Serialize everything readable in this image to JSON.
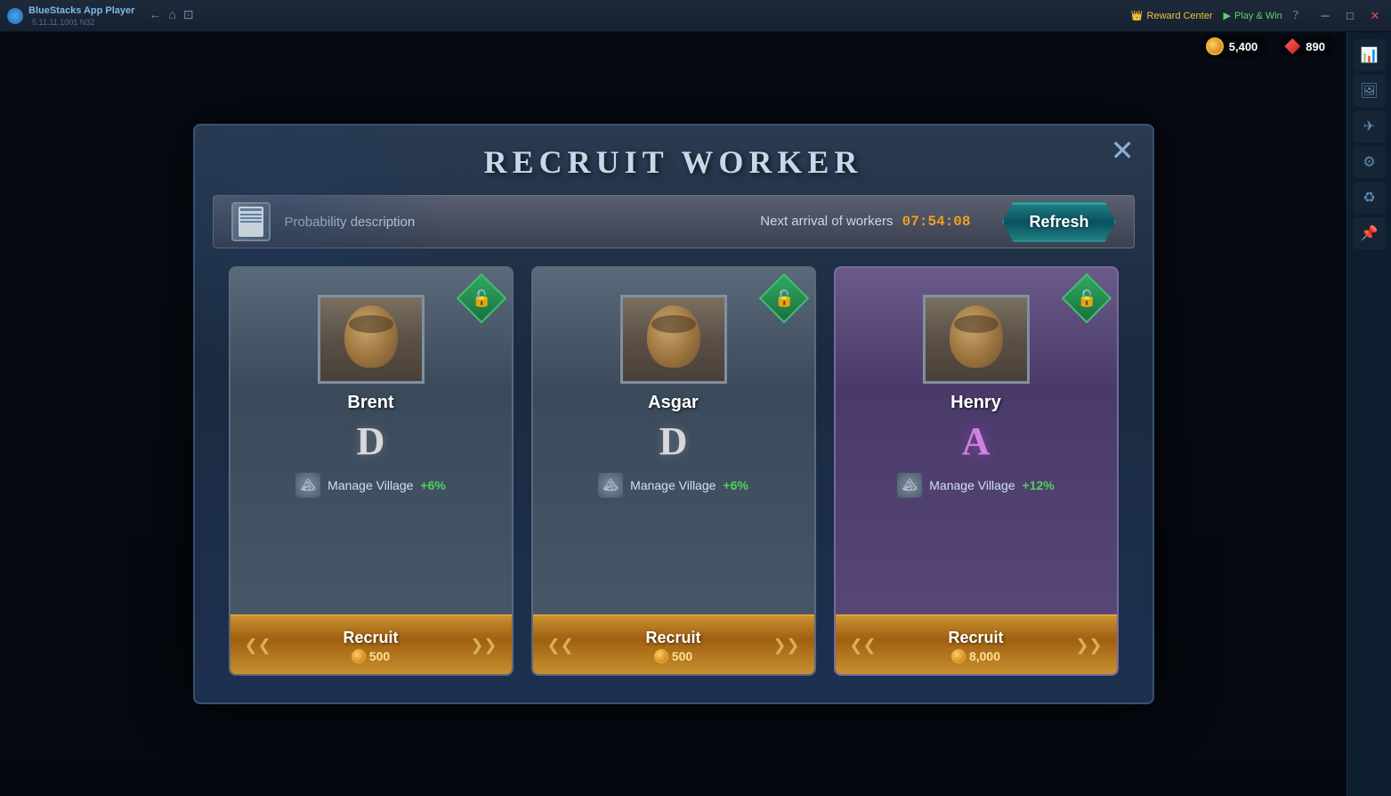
{
  "app": {
    "name": "BlueStacks App Player",
    "version": "5.11.11.1001 N32"
  },
  "titlebar": {
    "back_label": "←",
    "home_label": "⌂",
    "window_label": "⊡",
    "reward_center": "Reward Center",
    "play_win": "Play & Win",
    "minimize": "─",
    "maximize": "□",
    "close": "✕"
  },
  "currency": {
    "coins": "5,400",
    "gems": "890"
  },
  "modal": {
    "title": "RECRUIT WORKER",
    "close_label": "✕",
    "prob_label": "Probability description",
    "arrival_label": "Next arrival of workers",
    "timer": "07:54:08",
    "refresh_label": "Refresh"
  },
  "workers": [
    {
      "name": "Brent",
      "grade": "D",
      "grade_class": "grade-d",
      "skill_name": "Manage Village",
      "skill_bonus": "+6%",
      "recruit_label": "Recruit",
      "recruit_cost": "500",
      "card_class": "normal"
    },
    {
      "name": "Asgar",
      "grade": "D",
      "grade_class": "grade-d",
      "skill_name": "Manage Village",
      "skill_bonus": "+6%",
      "recruit_label": "Recruit",
      "recruit_cost": "500",
      "card_class": "normal"
    },
    {
      "name": "Henry",
      "grade": "A",
      "grade_class": "grade-a",
      "skill_name": "Manage Village",
      "skill_bonus": "+12%",
      "recruit_label": "Recruit",
      "recruit_cost": "8,000",
      "card_class": "rare"
    }
  ],
  "sidebar": {
    "icons": [
      "📊",
      "🖼",
      "✈",
      "⚙",
      "♻",
      "📌"
    ]
  }
}
